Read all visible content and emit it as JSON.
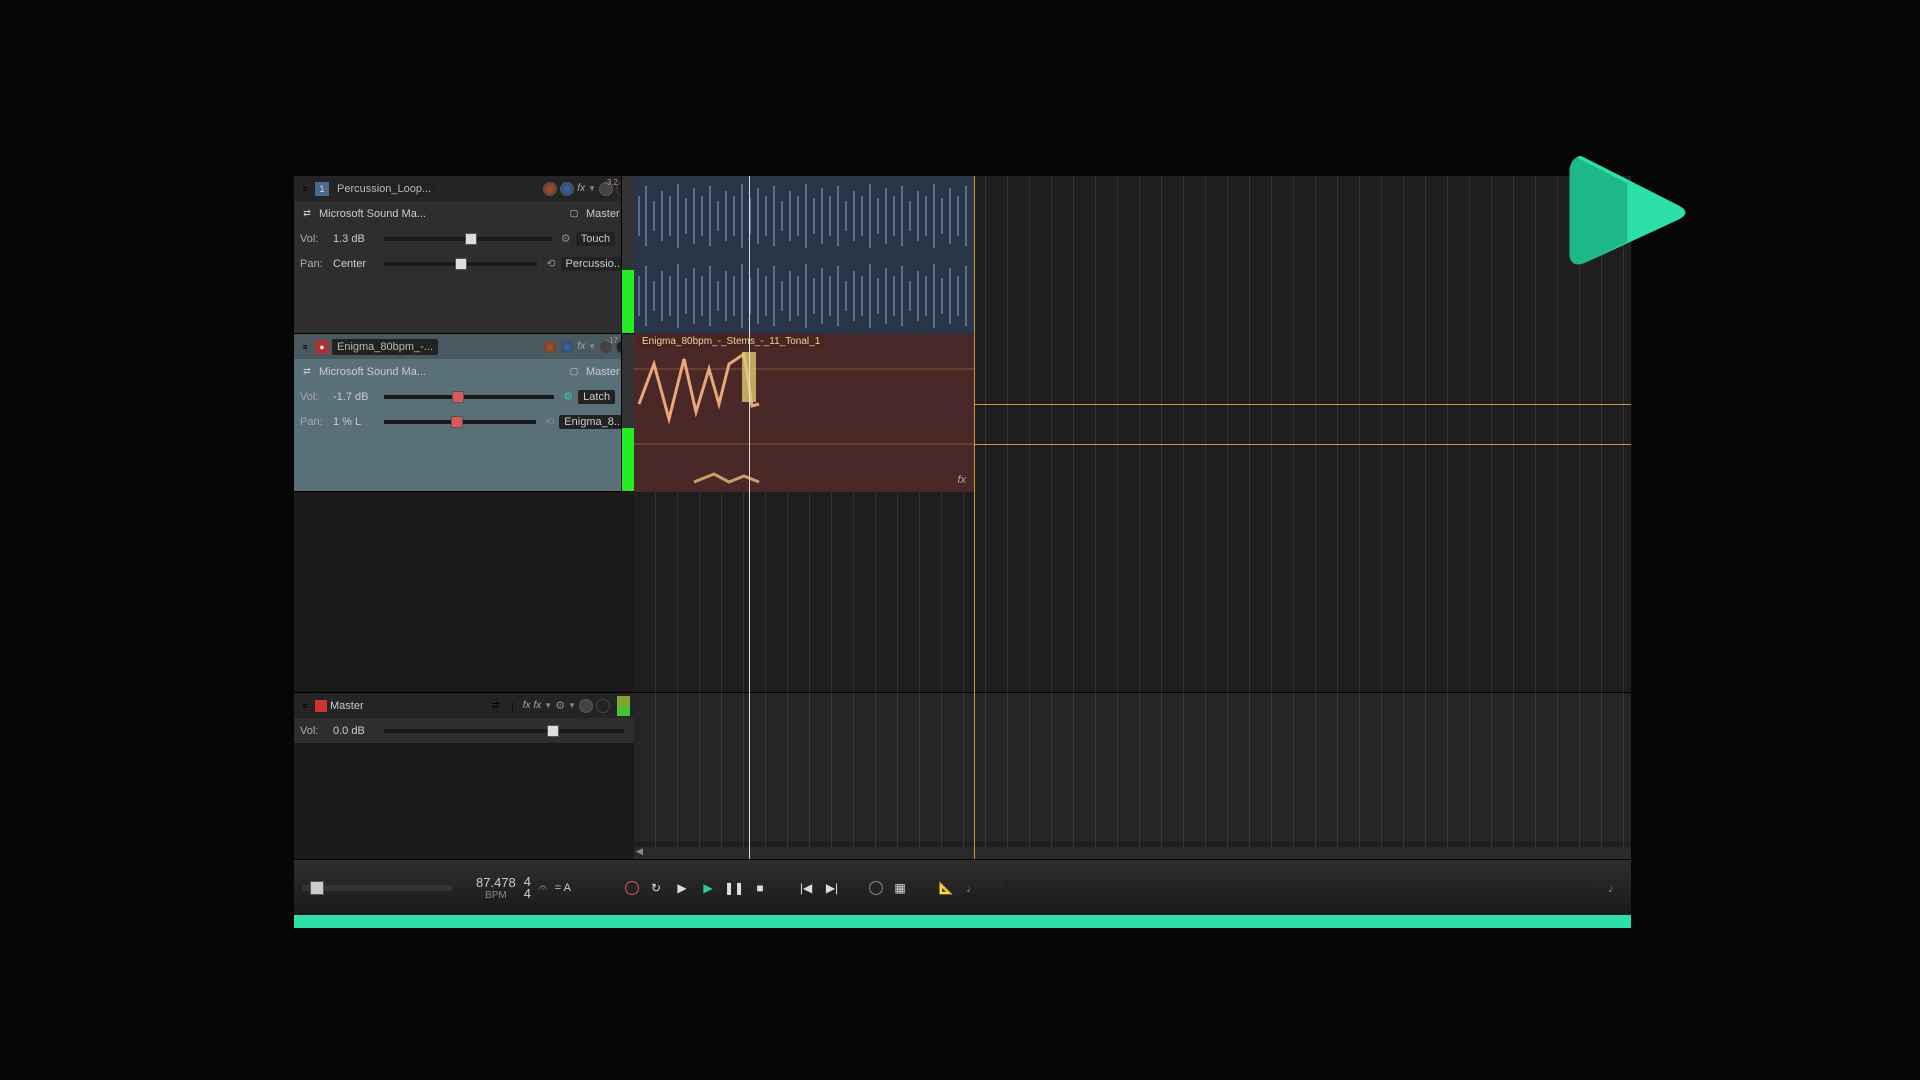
{
  "tracks": [
    {
      "number": "1",
      "name": "Percussion_Loop...",
      "output": "Microsoft Sound Ma...",
      "bus": "Master",
      "vol_label": "Vol:",
      "vol_value": "1.3 dB",
      "pan_label": "Pan:",
      "pan_value": "Center",
      "automation_mode": "Touch",
      "automation_target": "Percussio...",
      "meter_peak": "-3.2"
    },
    {
      "number": "",
      "name": "Enigma_80bpm_-...",
      "output": "Microsoft Sound Ma...",
      "bus": "Master",
      "vol_label": "Vol:",
      "vol_value": "-1.7 dB",
      "pan_label": "Pan:",
      "pan_value": "1 % L",
      "automation_mode": "Latch",
      "automation_target": "Enigma_8...",
      "meter_peak": "-17"
    }
  ],
  "master": {
    "name": "Master",
    "vol_label": "Vol:",
    "vol_value": "0.0 dB"
  },
  "clips": {
    "enigma_label": "Enigma_80bpm_-_Stems_-_11_Tonal_1",
    "fx_label": "fx"
  },
  "transport": {
    "bpm_value": "87.478",
    "bpm_label": "BPM",
    "timesig_num": "4",
    "timesig_den": "4",
    "key_label": "= A",
    "metronome_icon": "♩"
  }
}
